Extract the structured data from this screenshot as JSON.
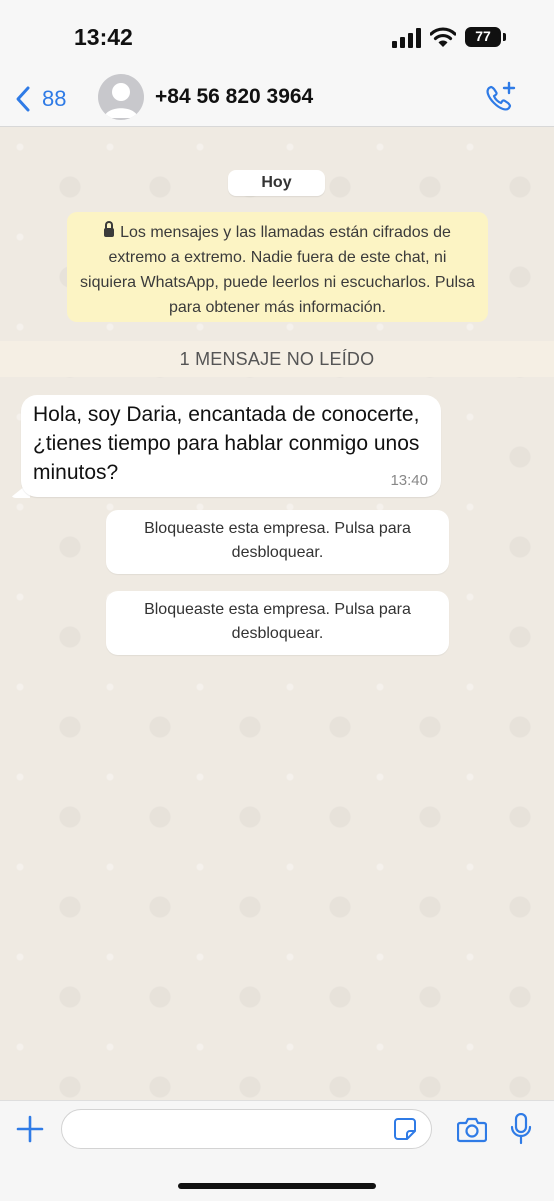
{
  "status_bar": {
    "time": "13:42",
    "battery": "77"
  },
  "header": {
    "back_count": "88",
    "contact_name": "+84 56 820 3964"
  },
  "chat": {
    "date_label": "Hoy",
    "encryption_notice": "Los mensajes y las llamadas están cifrados de extremo a extremo. Nadie fuera de este chat, ni siquiera WhatsApp, puede leerlos ni escucharlos. Pulsa para obtener más información.",
    "unread_banner": "1 MENSAJE NO LEÍDO",
    "messages": [
      {
        "text": "Hola, soy Daria, encantada de conocerte, ¿tienes tiempo para hablar conmigo unos minutos?",
        "time": "13:40"
      }
    ],
    "system_messages": [
      {
        "text": "Bloqueaste esta empresa. Pulsa para desbloquear."
      },
      {
        "text": "Bloqueaste esta empresa. Pulsa para desbloquear."
      }
    ]
  },
  "composer": {
    "placeholder": ""
  },
  "colors": {
    "accent": "#2f7be6",
    "chat_background": "#efeae2",
    "notice_background": "#fcf4c4"
  }
}
